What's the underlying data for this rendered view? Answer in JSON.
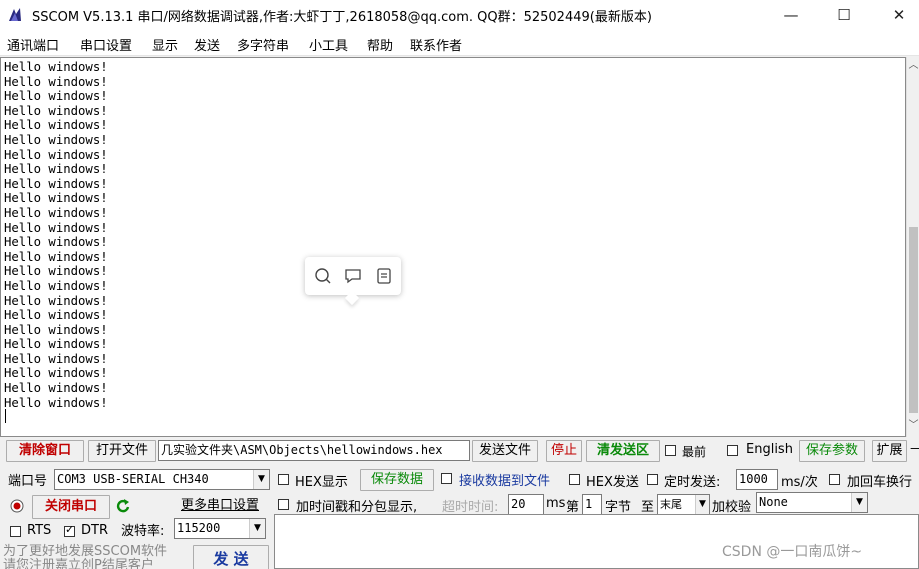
{
  "window": {
    "title": "SSCOM V5.13.1 串口/网络数据调试器,作者:大虾丁丁,2618058@qq.com. QQ群：52502449(最新版本)",
    "minimize": "—",
    "maximize": "☐",
    "close": "✕"
  },
  "menu": [
    "通讯端口",
    "串口设置",
    "显示",
    "发送",
    "多字符串",
    "小工具",
    "帮助",
    "联系作者"
  ],
  "console": {
    "lines": [
      "Hello windows!",
      "Hello windows!",
      "Hello windows!",
      "Hello windows!",
      "Hello windows!",
      "Hello windows!",
      "Hello windows!",
      "Hello windows!",
      "Hello windows!",
      "Hello windows!",
      "Hello windows!",
      "Hello windows!",
      "Hello windows!",
      "Hello windows!",
      "Hello windows!",
      "Hello windows!",
      "Hello windows!",
      "Hello windows!",
      "Hello windows!",
      "Hello windows!",
      "Hello windows!",
      "Hello windows!",
      "Hello windows!",
      "Hello windows!"
    ]
  },
  "toolbar": {
    "clear_window": "清除窗口",
    "open_file": "打开文件",
    "file_path": "几实验文件夹\\ASM\\Objects\\hellowindows.hex",
    "send_file": "发送文件",
    "stop": "停止",
    "clear_send": "清发送区",
    "topmost": "最前",
    "english": "English",
    "save_params": "保存参数",
    "expand": "扩展",
    "dash": "—"
  },
  "port": {
    "port_label": "端口号",
    "port_value": "COM3 USB-SERIAL CH340",
    "close_port": "关闭串口",
    "more_settings": "更多串口设置",
    "rts": "RTS",
    "dtr": "DTR",
    "baud_label": "波特率:",
    "baud_value": "115200"
  },
  "options": {
    "hex_display": "HEX显示",
    "save_data": "保存数据",
    "recv_to_file": "接收数据到文件",
    "hex_send": "HEX发送",
    "timed_send": "定时发送:",
    "interval": "1000",
    "interval_unit": "ms/次",
    "add_crlf": "加回车换行",
    "timestamp": "加时间戳和分包显示,",
    "timeout_label": "超时时间:",
    "timeout_value": "20",
    "ms": "ms",
    "nth": "第",
    "nth_value": "1",
    "bytes": "字节",
    "to": "至",
    "tail": "末尾",
    "checksum": "加校验",
    "checksum_value": "None"
  },
  "send_button": "发 送",
  "promo": [
    "为了更好地发展SSCOM软件",
    "请您注册嘉立创P结尾客户"
  ],
  "watermark": "CSDN @一口南瓜饼~"
}
